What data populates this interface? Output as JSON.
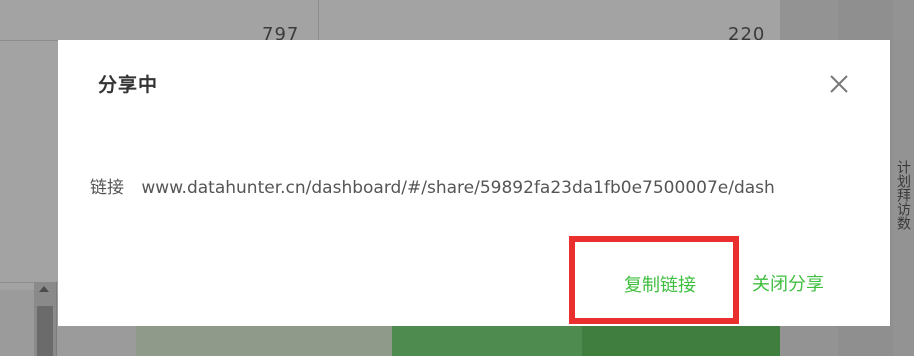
{
  "background": {
    "table_values": [
      "797",
      "220"
    ],
    "side_label": "计划拜访数",
    "colors": {
      "overlay": "#9b9b9b",
      "green_block_1": "#4e8b4e",
      "green_block_2": "#3f7e3f"
    }
  },
  "modal": {
    "title": "分享中",
    "close_icon": "close-icon",
    "link_label": "链接",
    "link_url": "www.datahunter.cn/dashboard/#/share/59892fa23da1fb0e7500007e/dash",
    "copy_button_label": "复制链接",
    "close_share_label": "关闭分享",
    "colors": {
      "accent_green": "#3fbf3f",
      "highlight_red": "#e9302f",
      "title": "#333333",
      "text": "#555555"
    }
  }
}
